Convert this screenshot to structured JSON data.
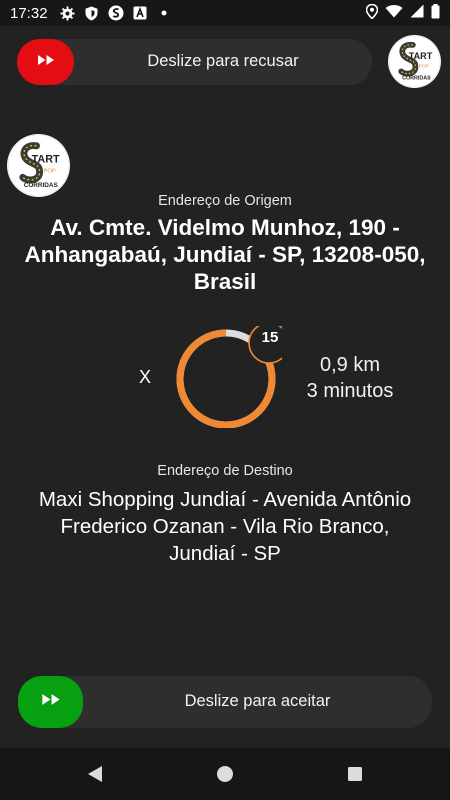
{
  "status_bar": {
    "time": "17:32",
    "left_icons": [
      "gear-icon",
      "shield-icon",
      "app-notification-icon",
      "text-a-icon",
      "dot-icon"
    ],
    "right_icons": [
      "location-icon",
      "wifi-icon",
      "signal-icon",
      "battery-icon"
    ]
  },
  "reject_slider": {
    "label": "Deslize para recusar",
    "icon": "fast-forward-icon",
    "color": "#e50d14"
  },
  "accept_slider": {
    "label": "Deslize para aceitar",
    "icon": "fast-forward-icon",
    "color": "#07a010"
  },
  "logo": {
    "brand_text": "START",
    "sub_text": "POP",
    "tagline": "CORRIDAS"
  },
  "origin": {
    "label": "Endereço de Origem",
    "line1": "Av. Cmte. Videlmo Munhoz, 190 -",
    "line2": "Anhangabaú, Jundiaí - SP, 13208-050,",
    "line3": "Brasil"
  },
  "destination": {
    "label": "Endereço de Destino",
    "line1": "Maxi Shopping Jundiaí - Avenida Antônio",
    "line2": "Frederico Ozanan - Vila Rio Branco,",
    "line3": "Jundiaí - SP"
  },
  "dismiss": {
    "label": "X"
  },
  "timer": {
    "seconds_left": "15",
    "remaining_fraction": 0.86,
    "accent_color": "#f08a32"
  },
  "trip": {
    "distance": "0,9 km",
    "duration": "3 minutos"
  },
  "nav_bar": {
    "icons": [
      "back-icon",
      "home-icon",
      "recents-icon"
    ]
  }
}
